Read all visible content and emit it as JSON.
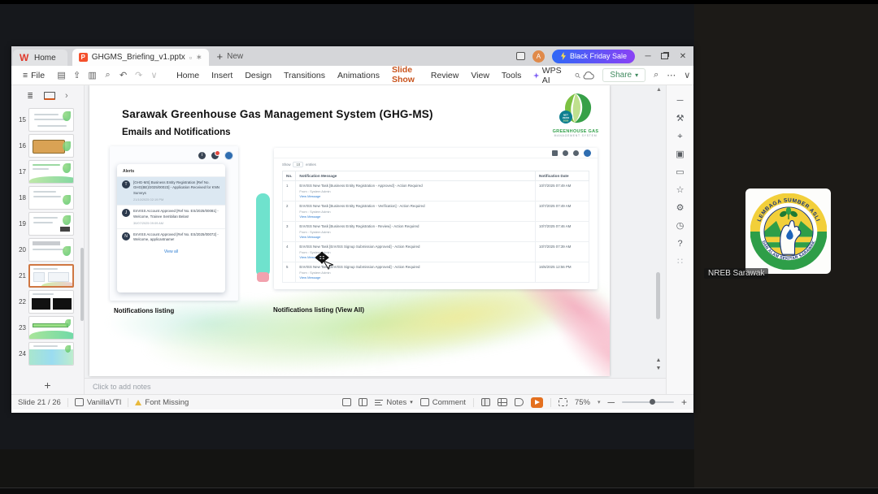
{
  "icons": {
    "hamburger": "≡",
    "chevron_right": "›",
    "caret_down": "▾",
    "collapse_chevron": "∨",
    "undo": "↶",
    "redo": "↷",
    "minimize": "─",
    "close": "✕",
    "plus": "+",
    "save": "▤",
    "export": "⇪",
    "print": "▥",
    "preview": "⌕",
    "ellipsis": "⋯",
    "outline_tab": "≣",
    "scroll_up": "▲",
    "scroll_dbl_up": "▲",
    "scroll_dbl_down": "▼",
    "doc_tab_window": "▫",
    "doc_tab_modified": "∗",
    "wps_logo": "W",
    "p_logo": "P",
    "avatar_letter": "A"
  },
  "titlebar": {
    "home_tab": "Home",
    "doc_tab": "GHGMS_Briefing_v1.pptx",
    "new_label": "New",
    "promo_label": "Black Friday Sale"
  },
  "menubar": {
    "file_label": "File",
    "items": [
      "Home",
      "Insert",
      "Design",
      "Transitions",
      "Animations",
      "Slide Show",
      "Review",
      "View",
      "Tools",
      "WPS AI"
    ],
    "active_item": "Slide Show",
    "share_label": "Share"
  },
  "thumbnails": {
    "numbers": [
      "15",
      "16",
      "17",
      "18",
      "19",
      "20",
      "21",
      "22",
      "23",
      "24"
    ],
    "selected": "21"
  },
  "rail": {
    "items": [
      {
        "name": "collapse",
        "glyph": "─"
      },
      {
        "name": "tools",
        "glyph": "⚒"
      },
      {
        "name": "select",
        "glyph": "⌖"
      },
      {
        "name": "shapes",
        "glyph": "▣"
      },
      {
        "name": "comment",
        "glyph": "▭"
      },
      {
        "name": "star",
        "glyph": "☆"
      },
      {
        "name": "settings",
        "glyph": "⚙"
      },
      {
        "name": "history",
        "glyph": "◷"
      },
      {
        "name": "help",
        "glyph": "?"
      },
      {
        "name": "apps",
        "glyph": "∷"
      }
    ]
  },
  "slide": {
    "title": "Sarawak Greenhouse Gas Management System (GHG-MS)",
    "subtitle": "Emails and Notifications",
    "brand": {
      "badge": "NET ZERO 2050",
      "line1": "GREENHOUSE GAS",
      "line2": "MANAGEMENT SYSTEM"
    },
    "caption_left": "Notifications listing",
    "caption_right": "Notifications listing (View All)",
    "alerts_panel": {
      "header": "Alerts",
      "items": [
        {
          "avatar": "T",
          "text": "[GHG-MS] Business Entity Registration [Ref No. GHG(BE)/2025/00023] - Application Received for KNN Surveys",
          "time": "21/10/2025 02:19 PM"
        },
        {
          "avatar": "J",
          "text": "EnVISS Account Approved [Ref No. ES/2025/00081] - Welcome, Trainee Sembilan Belas!",
          "time": "30/07/2025 09:09 AM"
        },
        {
          "avatar": "N",
          "text": "EnVISS Account Approved [Ref No. ES/2025/00072] - Welcome, applicantname!",
          "time": ""
        }
      ],
      "view_all": "View all"
    },
    "table_panel": {
      "show_label": "Show",
      "page_size": "10",
      "entries_label": "entries",
      "columns": [
        "No.",
        "Notification Message",
        "Notification Date"
      ],
      "rows": [
        {
          "no": "1",
          "message": "EnVISS New Task [Business Entity Registration - Approved] - Action Required",
          "from": "From : System Admin",
          "link": "View Message",
          "date": "10/7/2025 07:49 AM"
        },
        {
          "no": "2",
          "message": "EnVISS New Task [Business Entity Registration - Verification] - Action Required",
          "from": "From : System Admin",
          "link": "View Message",
          "date": "10/7/2025 07:49 AM"
        },
        {
          "no": "3",
          "message": "EnVISS New Task [Business Entity Registration - Review] - Action Required",
          "from": "From : System Admin",
          "link": "View Message",
          "date": "10/7/2025 07:46 AM"
        },
        {
          "no": "4",
          "message": "EnVISS New Task [EnVISS Signup Submission Approved] - Action Required",
          "from": "From : System Admin",
          "link": "View Message",
          "date": "10/7/2025 07:39 AM"
        },
        {
          "no": "5",
          "message": "EnVISS New Task [EnVISS Signup Submission Approved] - Action Required",
          "from": "From : System Admin",
          "link": "View Message",
          "date": "16/6/2025 12:56 PM"
        }
      ]
    },
    "notes_placeholder": "Click to add notes"
  },
  "statusbar": {
    "slide_indicator": "Slide 21 / 26",
    "theme_name": "VanillaVTI",
    "font_missing": "Font Missing",
    "notes_label": "Notes",
    "comment_label": "Comment",
    "zoom_level": "75%"
  },
  "participant": {
    "label": "NREB Sarawak",
    "logo_top_text": "LEMBAGA SUMBER ASLI",
    "logo_bottom_text": "DAN ALAM SEKITAR SARAWAK"
  }
}
